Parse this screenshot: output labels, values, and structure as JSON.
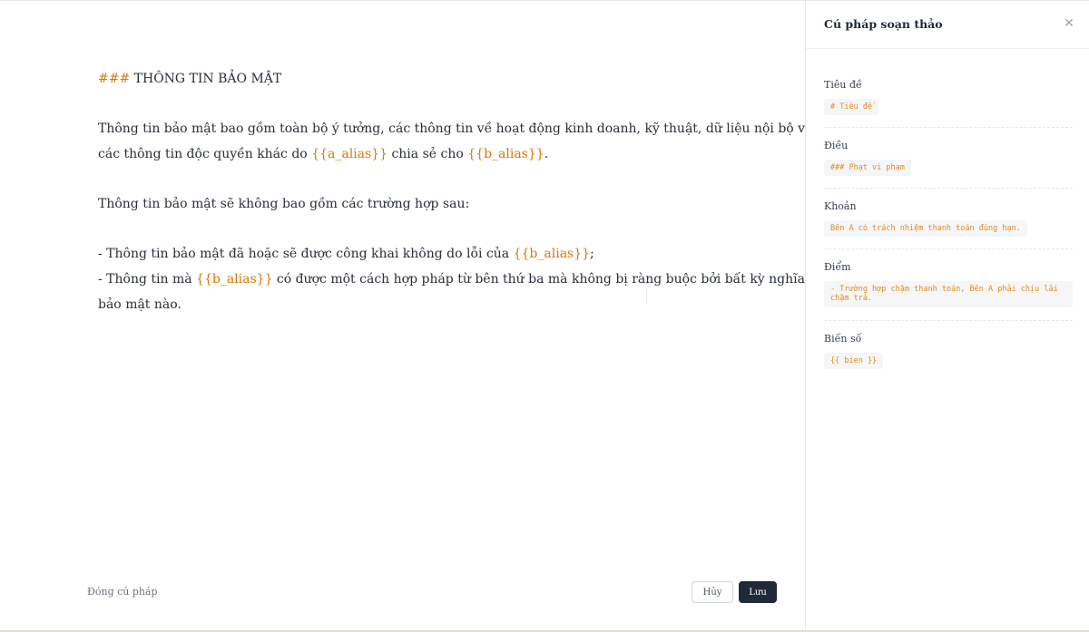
{
  "editor": {
    "lines": {
      "heading": {
        "prefix": "###",
        "text": " THÔNG TIN BẢO MẬT"
      },
      "p1a": {
        "text": "Thông tin bảo mật bao gồm toàn bộ ý tưởng, các thông tin về hoạt động kinh doanh, kỹ thuật, dữ liệu nội bộ và"
      },
      "p1b": {
        "pre": "các thông tin độc quyền khác do ",
        "var1": "{{a_alias}}",
        "mid": " chia sẻ cho ",
        "var2": "{{b_alias}}",
        "post": "."
      },
      "p2": {
        "text": "Thông tin bảo mật sẽ không bao gồm các trường hợp sau:"
      },
      "b1": {
        "pre": "- Thông tin bảo mật đã hoặc sẽ được công khai không do lỗi của ",
        "var": "{{b_alias}}",
        "post": ";"
      },
      "b2": {
        "pre": "- Thông tin mà ",
        "var": "{{b_alias}}",
        "post": " có được một cách hợp pháp từ bên thứ ba mà không bị ràng buộc bởi bất kỳ nghĩa vụ"
      },
      "b3": {
        "text": "bảo mật nào."
      }
    }
  },
  "footer": {
    "close_syntax_label": "Đóng cú pháp",
    "cancel_label": "Hủy",
    "save_label": "Lưu"
  },
  "panel": {
    "title": "Cú pháp soạn thảo",
    "close_icon": "close-icon",
    "sections": [
      {
        "label": "Tiêu đề",
        "code": "# Tiêu đề"
      },
      {
        "label": "Điều",
        "code": "### Phạt vi phạm"
      },
      {
        "label": "Khoản",
        "code": "Bên A có trách nhiệm thanh toán đúng hạn."
      },
      {
        "label": "Điểm",
        "code": "- Trường hợp chậm thanh toán, Bên A phải chịu lãi chậm trả."
      },
      {
        "label": "Biến số",
        "code": "{{ bien }}"
      }
    ]
  },
  "colors": {
    "accent": "#d97706",
    "primary_button": "#1f2937",
    "code_text": "#e08a1e"
  }
}
